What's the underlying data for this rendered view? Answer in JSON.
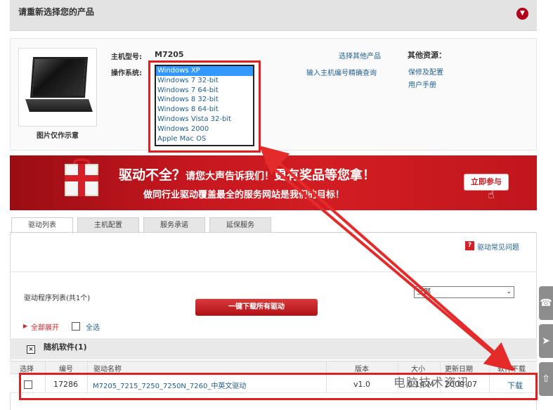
{
  "header": {
    "title": "请重新选择您的产品",
    "toggle_icon": "chevron-down-icon"
  },
  "product": {
    "image_caption": "图片仅作示意",
    "model_label": "主机型号:",
    "model_value": "M7205",
    "os_label": "操作系统:",
    "os_options": [
      "Windows XP",
      "Windows 7 32-bit",
      "Windows 7 64-bit",
      "Windows 8 32-bit",
      "Windows 8 64-bit",
      "Windows Vista 32-bit",
      "Windows 2000",
      "Apple Mac OS"
    ],
    "os_selected": "Windows XP",
    "select_other_link": "选择其他产品",
    "serial_query_link": "输入主机编号精确查询",
    "other_resources_title": "其他资源：",
    "warranty_link": "保修及配置",
    "manual_link": "用户手册"
  },
  "banner": {
    "headline_part1": "驱动不全？",
    "headline_part2": "请您大声告诉我们！",
    "headline_part3": "更有奖品等您拿！",
    "subline": "做同行业驱动覆盖最全的服务网站是我们的目标！",
    "join_button": "立即参与"
  },
  "tabs": [
    {
      "label": "驱动列表",
      "active": true
    },
    {
      "label": "主机配置",
      "active": false
    },
    {
      "label": "服务承诺",
      "active": false
    },
    {
      "label": "延保服务",
      "active": false
    }
  ],
  "faq": {
    "icon": "question-icon",
    "label": "驱动常见问题"
  },
  "driver_list": {
    "title": "驱动程序列表(共1个)",
    "filter_value": "全部",
    "download_all_button": "一键下载所有驱动",
    "expand_all": "全部展开",
    "select_all": "全选",
    "section_title": "随机软件(1)",
    "columns": [
      "选择",
      "编号",
      "驱动名称",
      "版本",
      "大小",
      "更新日期",
      "软件下载"
    ],
    "rows": [
      {
        "id": "17286",
        "name": "M7205_7215_7250_7250N_7260_中英文驱动",
        "version": "v1.0",
        "size": "0.14 M",
        "date": "2009-07",
        "download": "下载"
      }
    ]
  },
  "watermark": "电脑技术资讯",
  "colors": {
    "accent_red": "#d52027",
    "link_blue": "#1f5f8c",
    "highlight_red": "#e02020",
    "select_blue": "#3399ff"
  }
}
